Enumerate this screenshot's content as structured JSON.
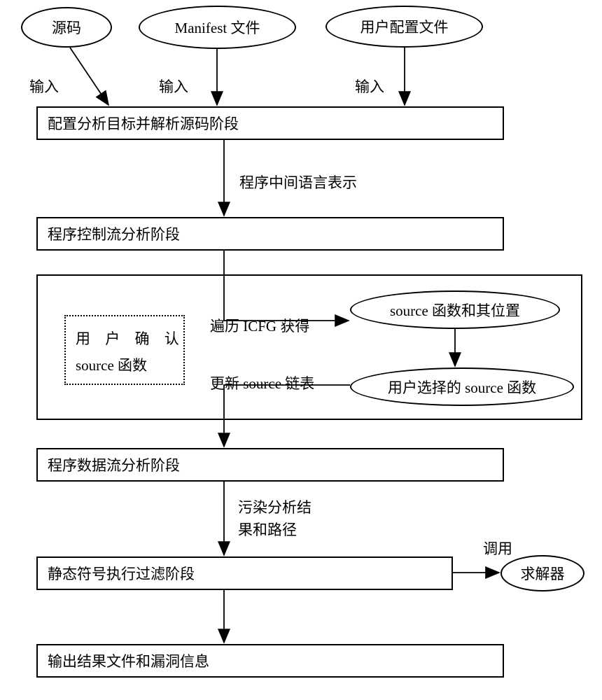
{
  "inputs": {
    "source": "源码",
    "manifest": "Manifest 文件",
    "userconfig": "用户配置文件",
    "input_label": "输入"
  },
  "stages": {
    "configure": "配置分析目标并解析源码阶段",
    "controlflow": "程序控制流分析阶段",
    "userconfirm_line1": "用  户  确  认",
    "userconfirm_line2": "source 函数",
    "sourcefunc_loc": "source 函数和其位置",
    "userselected_source": "用户选择的 source 函数",
    "dataflow": "程序数据流分析阶段",
    "symbolic": "静态符号执行过滤阶段",
    "output": "输出结果文件和漏洞信息"
  },
  "edges": {
    "il_repr": "程序中间语言表示",
    "traverse_icfg": "遍历 ICFG 获得",
    "update_source": "更新 source 链表",
    "taint_line1": "污染分析结",
    "taint_line2": "果和路径",
    "call": "调用",
    "solver": "求解器"
  }
}
